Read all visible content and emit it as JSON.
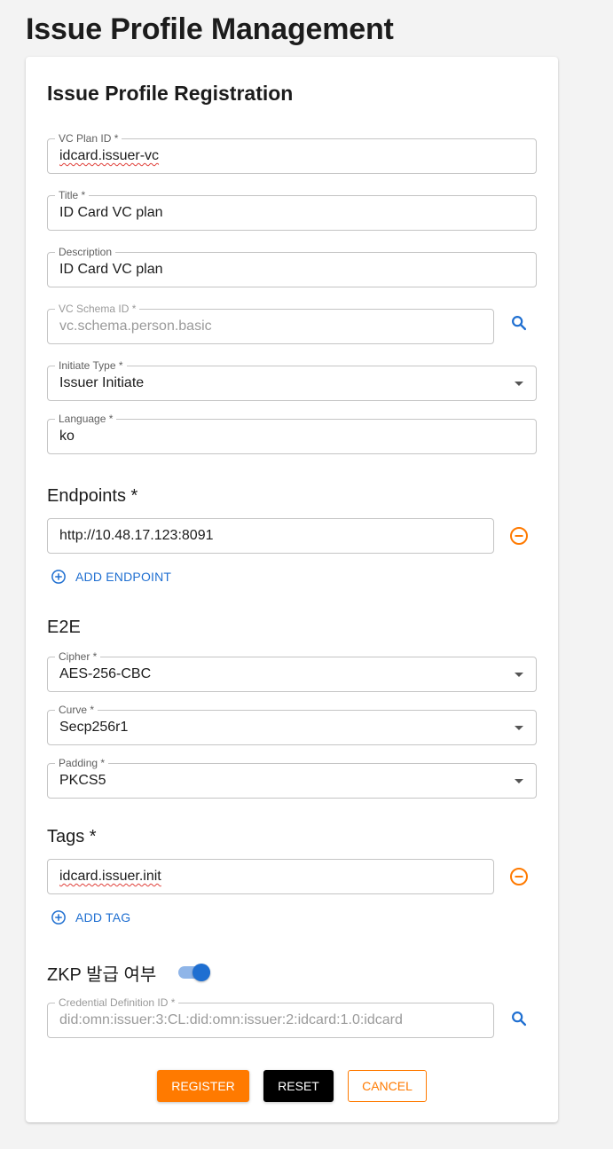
{
  "page": {
    "title": "Issue Profile Management"
  },
  "form": {
    "title": "Issue Profile Registration",
    "vc_plan_id": {
      "label": "VC Plan ID *",
      "value": "idcard.issuer-vc"
    },
    "title_field": {
      "label": "Title *",
      "value": "ID Card VC plan"
    },
    "description": {
      "label": "Description",
      "value": "ID Card VC plan"
    },
    "vc_schema_id": {
      "label": "VC Schema ID *",
      "value": "vc.schema.person.basic",
      "icon": "search-icon"
    },
    "initiate_type": {
      "label": "Initiate Type *",
      "value": "Issuer Initiate"
    },
    "language": {
      "label": "Language *",
      "value": "ko"
    },
    "endpoints": {
      "title": "Endpoints *",
      "items": [
        "http://10.48.17.123:8091"
      ],
      "add_label": "ADD ENDPOINT"
    },
    "e2e": {
      "title": "E2E",
      "cipher": {
        "label": "Cipher *",
        "value": "AES-256-CBC"
      },
      "curve": {
        "label": "Curve *",
        "value": "Secp256r1"
      },
      "padding": {
        "label": "Padding *",
        "value": "PKCS5"
      }
    },
    "tags": {
      "title": "Tags *",
      "items": [
        "idcard.issuer.init"
      ],
      "add_label": "ADD TAG"
    },
    "zkp": {
      "label": "ZKP 발급 여부",
      "enabled": true
    },
    "credential_definition_id": {
      "label": "Credential Definition ID *",
      "value": "did:omn:issuer:3:CL:did:omn:issuer:2:idcard:1.0:idcard"
    },
    "buttons": {
      "register": "REGISTER",
      "reset": "RESET",
      "cancel": "CANCEL"
    }
  },
  "colors": {
    "accent": "#ff7a00",
    "primary": "#1f6fd1",
    "reset": "#000000",
    "background": "#f3f3f3"
  }
}
